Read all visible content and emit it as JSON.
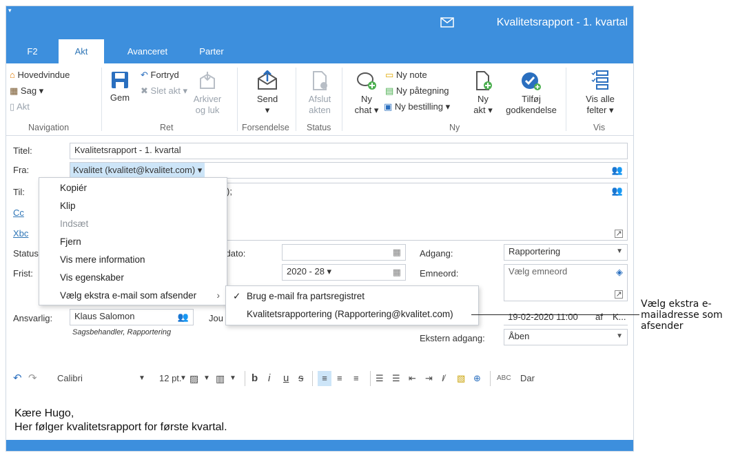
{
  "titlebar": {
    "title": "Kvalitetsrapport - 1. kvartal",
    "quick_access": "▾"
  },
  "tabs": [
    {
      "label": "F2",
      "active": false
    },
    {
      "label": "Akt",
      "active": true
    },
    {
      "label": "Avanceret",
      "active": false
    },
    {
      "label": "Parter",
      "active": false
    }
  ],
  "ribbon": {
    "navigation": {
      "hovedvindue": "Hovedvindue",
      "sag": "Sag ▾",
      "akt": "Akt",
      "group": "Navigation"
    },
    "ret": {
      "gem": "Gem",
      "fortryd": "Fortryd",
      "slet_akt": "Slet akt ▾",
      "arkiver_line1": "Arkiver",
      "arkiver_line2": "og luk",
      "group": "Ret"
    },
    "forsendelse": {
      "send": "Send",
      "send_caret": "▾",
      "group": "Forsendelse"
    },
    "status": {
      "afslut_line1": "Afslut",
      "afslut_line2": "akten",
      "group": "Status"
    },
    "ny": {
      "chat_line1": "Ny",
      "chat_line2": "chat ▾",
      "ny_note": "Ny note",
      "ny_paategning": "Ny påtegning",
      "ny_bestilling": "Ny bestilling ▾",
      "akt_line1": "Ny",
      "akt_line2": "akt ▾",
      "tilfoej_line1": "Tilføj",
      "tilfoej_line2": "godkendelse",
      "group": "Ny"
    },
    "vis": {
      "line1": "Vis alle",
      "line2": "felter ▾",
      "group": "Vis"
    }
  },
  "form": {
    "titel_label": "Titel:",
    "titel_value": "Kvalitetsrapport - 1. kvartal",
    "fra_label": "Fra:",
    "fra_value": "Kvalitet (kvalitet@kvalitet.com) ▾",
    "til_label": "Til:",
    "til_value_partial": ");",
    "cc_label": "Cc",
    "xbc_label": "Xbc",
    "status_label": "Status",
    "dato_label": "ydato:",
    "frist_label": "Frist:",
    "frist_value": "2020 - 28 ▾",
    "adgang_label": "Adgang:",
    "adgang_value": "Rapportering",
    "emneord_label": "Emneord:",
    "emneord_placeholder": "Vælg emneord",
    "ansvarlig_label": "Ansvarlig:",
    "ansvarlig_value": "Klaus Salomon",
    "ansvarlig_sub": "Sagsbehandler, Rapportering",
    "jou_label": "Jou",
    "date_label_partial": "):",
    "date_value": "19-02-2020 11:00",
    "af_label": "af",
    "af_value": "K...",
    "ekstern_label": "Ekstern adgang:",
    "ekstern_value": "Åben"
  },
  "context_menu": {
    "items": [
      {
        "label": "Kopiér",
        "disabled": false
      },
      {
        "label": "Klip",
        "disabled": false
      },
      {
        "label": "Indsæt",
        "disabled": true
      },
      {
        "label": "Fjern",
        "disabled": false
      },
      {
        "label": "Vis mere information",
        "disabled": false
      },
      {
        "label": "Vis egenskaber",
        "disabled": false
      },
      {
        "label": "Vælg ekstra e-mail som afsender",
        "disabled": false
      }
    ],
    "submenu_arrow": "›"
  },
  "submenu": {
    "items": [
      {
        "label": "Brug e-mail fra partsregistret",
        "checked": true
      },
      {
        "label": "Kvalitetsrapportering (Rapportering@kvalitet.com)",
        "checked": false
      }
    ],
    "check": "✓"
  },
  "toolbar": {
    "font": "Calibri",
    "size": "12 pt.",
    "bold": "b",
    "italic": "i",
    "underline": "u",
    "strike": "s",
    "more": "Dar"
  },
  "body": {
    "line1": "Kære Hugo,",
    "line2": "Her følger kvalitetsrapport for første kvartal."
  },
  "callout": {
    "line1": "Vælg ekstra e-",
    "line2": "mailadresse som",
    "line3": "afsender"
  },
  "colors": {
    "accent": "#3d8fdd",
    "tab_text": "#2e75b6",
    "selected_bg": "#cde5f8"
  }
}
